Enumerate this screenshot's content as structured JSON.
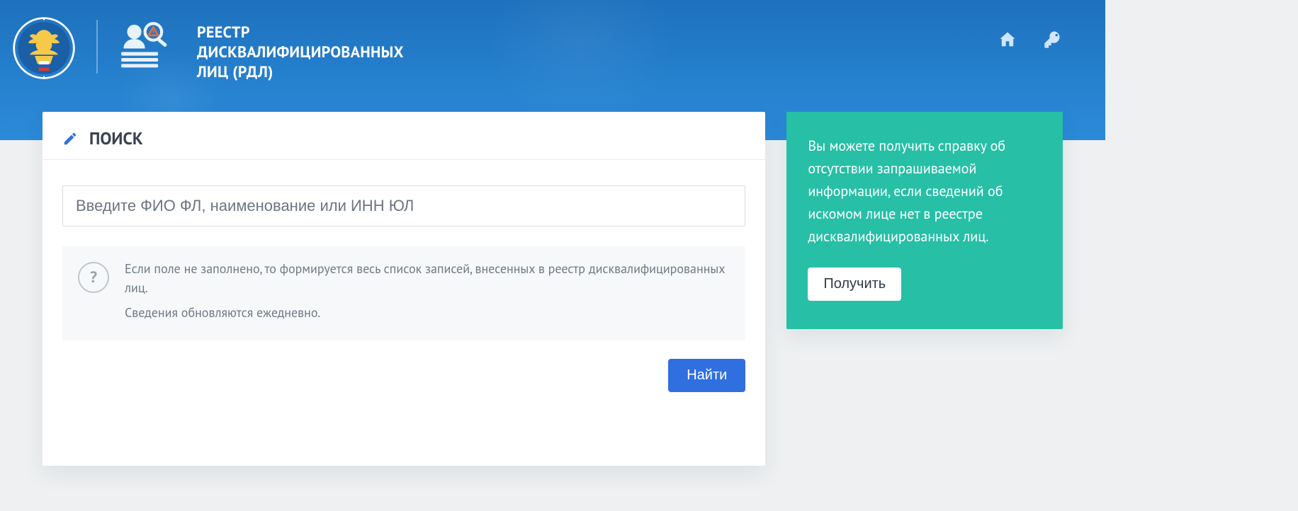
{
  "header": {
    "title_line1": "РЕЕСТР",
    "title_line2": "ДИСКВАЛИФИЦИРОВАННЫХ",
    "title_line3": "ЛИЦ (РДЛ)"
  },
  "search": {
    "title": "ПОИСК",
    "placeholder": "Введите ФИО ФЛ, наименование или ИНН ЮЛ",
    "value": "",
    "hint_line1": "Если поле не заполнено, то формируется весь список записей, внесенных в реестр дисквалифицированных лиц.",
    "hint_line2": "Сведения обновляются ежедневно.",
    "submit_label": "Найти"
  },
  "side": {
    "text": "Вы можете получить справку об отсутствии запрашиваемой информации, если сведений об искомом лице нет в реестре дисквалифицированных лиц.",
    "cta_label": "Получить"
  }
}
